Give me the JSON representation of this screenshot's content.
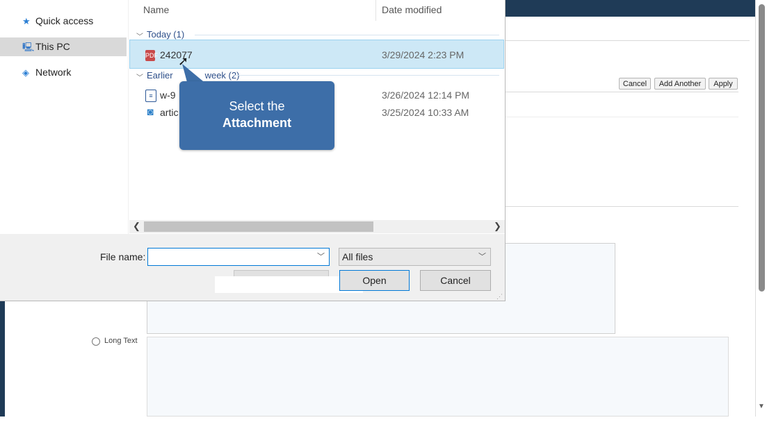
{
  "background_page": {
    "buttons": {
      "cancel": "Cancel",
      "add_another": "Add Another",
      "apply": "Apply"
    },
    "long_text_label": "Long Text"
  },
  "dialog": {
    "nav": [
      {
        "label": "Quick access",
        "icon": "star-icon"
      },
      {
        "label": "This PC",
        "icon": "computer-icon",
        "selected": true
      },
      {
        "label": "Network",
        "icon": "network-icon"
      }
    ],
    "columns": {
      "name": "Name",
      "date_modified": "Date modified"
    },
    "groups": [
      {
        "label": "Today (1)",
        "files": [
          {
            "name": "242077",
            "date": "3/29/2024 2:23 PM",
            "icon": "pdf-icon",
            "selected": true
          }
        ]
      },
      {
        "label": "Earlier this week (2)",
        "visible_label": "Earlier",
        "visible_label_end": "week (2)",
        "files": [
          {
            "name": "w-9",
            "date": "3/26/2024 12:14 PM",
            "icon": "document-icon"
          },
          {
            "name": "artic",
            "date": "3/25/2024 10:33 AM",
            "icon": "search-document-icon"
          }
        ]
      }
    ],
    "file_name_label": "File name:",
    "file_name_value": "",
    "file_type": "All files",
    "open_button": "Open",
    "cancel_button": "Cancel"
  },
  "callout": {
    "line1": "Select the",
    "line2": "Attachment",
    "color": "#3d6ea8"
  },
  "colors": {
    "header": "#1f3b57",
    "selection": "#cde8f6",
    "accent": "#0078d7"
  }
}
